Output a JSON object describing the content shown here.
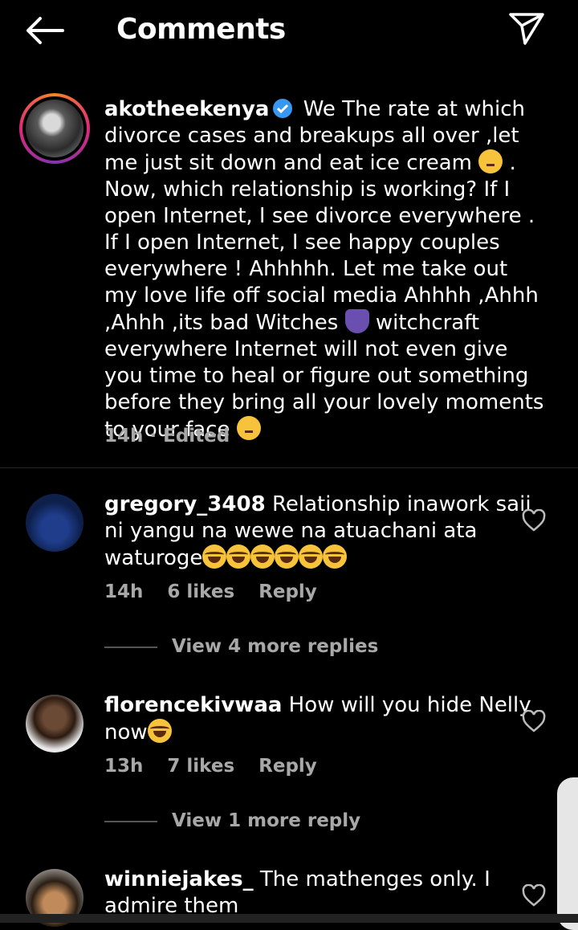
{
  "header": {
    "title": "Comments"
  },
  "caption": {
    "username": "akotheekenya",
    "text_1": "We The rate at which divorce cases and breakups all over ,let me just sit down and eat ice cream",
    "text_2": ". Now, which relationship is working? If I open Internet, I see divorce everywhere . If I open Internet, I see happy couples everywhere ! Ahhhhh. Let me take out my love life off social media Ahhhh ,Ahhh ,Ahhh ,its bad Witches",
    "text_3": "witchcraft everywhere Internet will not even give you time to heal or figure out something before they bring all your lovely moments to your face",
    "meta": "14h · Edited"
  },
  "comments": [
    {
      "username": "gregory_3408",
      "text": "Relationship inawork saii ni yangu na wewe na atuachani ata waturoge",
      "time": "14h",
      "likes": "6 likes",
      "reply": "Reply",
      "view_replies": "View 4 more replies"
    },
    {
      "username": "florencekivwaa",
      "text": "How will you hide Nelly now",
      "time": "13h",
      "likes": "7 likes",
      "reply": "Reply",
      "view_replies": "View 1 more reply"
    },
    {
      "username": "winniejakes_",
      "text": "The mathenges only. I admire them"
    }
  ]
}
